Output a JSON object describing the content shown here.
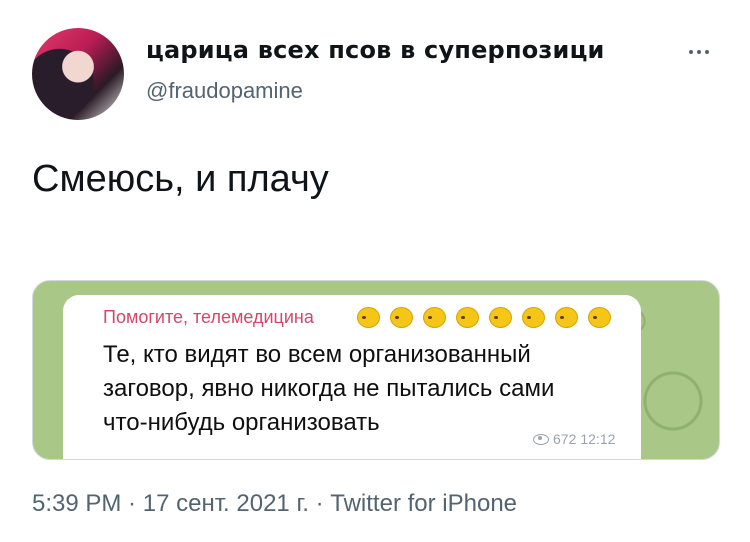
{
  "author": {
    "display_name": "царица всех псов в суперпозици",
    "handle": "@fraudopamine"
  },
  "tweet": {
    "text": "Смеюсь, и плачу"
  },
  "media": {
    "sender": "Помогите, телемедицина",
    "emoji": [
      "face-with-hand-over-mouth",
      "face-with-hand-over-mouth",
      "face-with-hand-over-mouth",
      "face-with-hand-over-mouth",
      "face-with-hand-over-mouth",
      "face-with-hand-over-mouth",
      "face-with-hand-over-mouth",
      "face-with-hand-over-mouth"
    ],
    "message_lines": [
      "Те, кто видят во всем организованный",
      "заговор, явно никогда не пытались сами",
      "что-нибудь организовать"
    ],
    "views": "672",
    "time": "12:12"
  },
  "footer": {
    "time": "5:39 PM",
    "sep1": " · ",
    "date_day": "17 ",
    "date_month": "сент",
    "date_year_pre": ". 2021 ",
    "date_year_g": "г",
    "date_year_post": ".",
    "sep2": " · ",
    "source": "Twitter for iPhone"
  },
  "colors": {
    "sender": "#d2486a",
    "telegram_bg": "#a9c787",
    "muted": "#536471"
  }
}
